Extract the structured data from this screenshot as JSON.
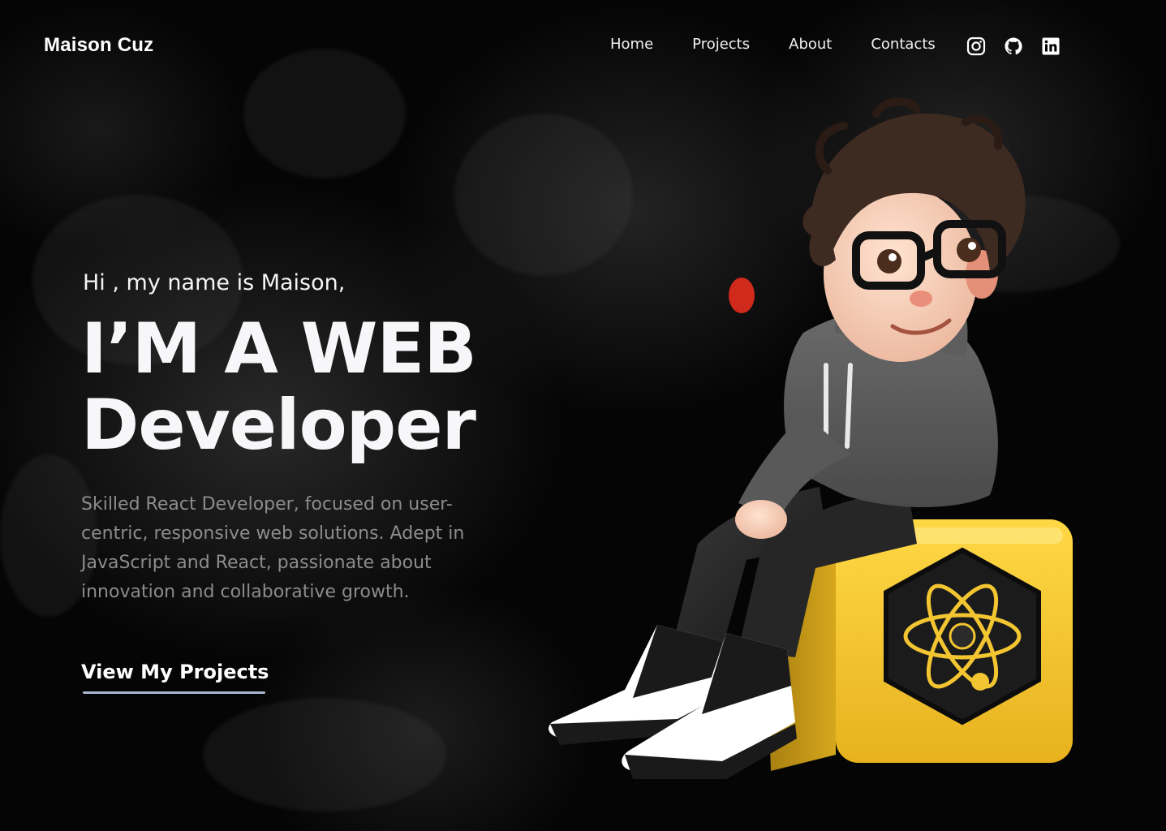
{
  "nav": {
    "logo": "Maison Cuz",
    "links": [
      {
        "label": "Home"
      },
      {
        "label": "Projects"
      },
      {
        "label": "About"
      },
      {
        "label": "Contacts"
      }
    ],
    "socials": [
      "instagram-icon",
      "github-icon",
      "linkedin-icon"
    ]
  },
  "hero": {
    "greeting": "Hi , my name is Maison,",
    "headline_line1": "I’M A WEB",
    "headline_line2": "Developer",
    "description": "Skilled React Developer, focused on user-centric, responsive web solutions. Adept in JavaScript and React, passionate about innovation and collaborative growth.",
    "cta_label": "View My Projects"
  },
  "colors": {
    "background": "#050505",
    "text_primary": "#f7f7f9",
    "text_muted": "#8c8c8c",
    "cta_underline": "#a9b6cc",
    "cube_yellow": "#f3c62d"
  }
}
